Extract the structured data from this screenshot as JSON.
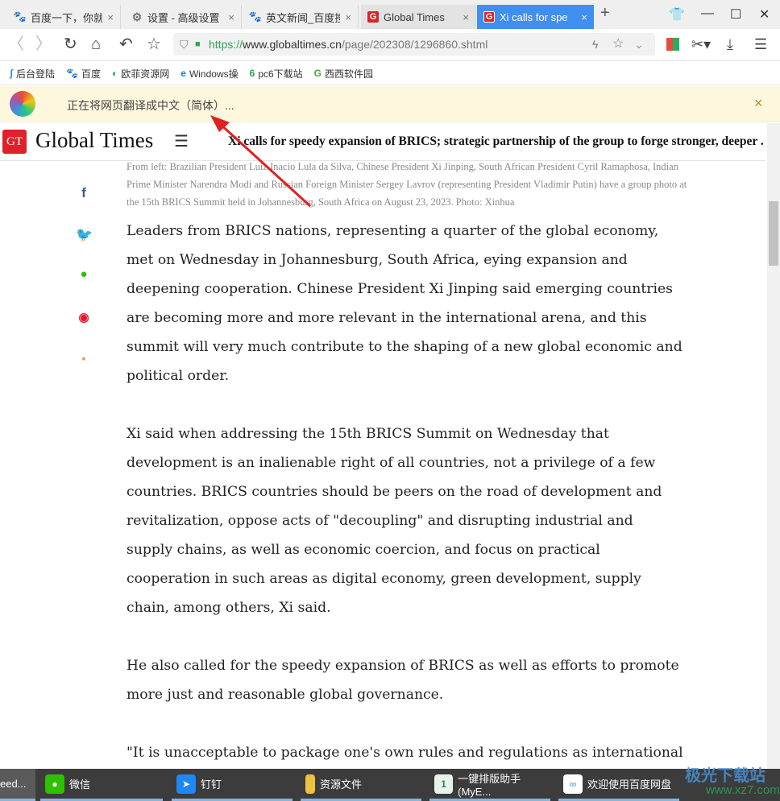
{
  "tabs": [
    {
      "label": "百度一下，你就",
      "icon": "baidu-paw-icon"
    },
    {
      "label": "设置 - 高级设置",
      "icon": "gear-icon"
    },
    {
      "label": "英文新闻_百度搜",
      "icon": "baidu-paw-icon"
    },
    {
      "label": "Global Times",
      "icon": "gt-icon"
    },
    {
      "label": "Xi calls for spe",
      "icon": "gt-icon",
      "active": true
    }
  ],
  "address": {
    "scheme": "https://",
    "host": "www.globaltimes.cn",
    "path": "/page/202308/1296860.shtml"
  },
  "bookmarks": [
    "后台登陆",
    "百度",
    "欧菲资源网",
    "Windows操",
    "pc6下载站",
    "西西软件园"
  ],
  "translate_bar": {
    "text": "正在将网页翻译成中文（简体）...",
    "close": "×"
  },
  "site": {
    "logo": "GT",
    "name": "Global Times",
    "headline": "Xi calls for speedy expansion of BRICS; strategic partnership of the group to forge stronger, deeper ..."
  },
  "caption": "From left: Brazilian President Luiz Inacio Lula da Silva, Chinese President Xi Jinping, South African President Cyril Ramaphosa, Indian Prime Minister Narendra Modi and Russian Foreign Minister Sergey Lavrov (representing President Vladimir Putin) have a group photo at the 15th BRICS Summit held in Johannesburg, South Africa on August 23, 2023. Photo: Xinhua",
  "article": [
    [
      "Leaders from BRICS nations, representing a quarter of the global economy,",
      "met on Wednesday in Johannesburg, South Africa, eying expansion and",
      "deepening cooperation. Chinese President Xi Jinping said emerging countries",
      "are becoming more and more relevant in the international arena, and this",
      "summit will very much contribute to the shaping of a new global economic and",
      "political order."
    ],
    [
      "Xi said when addressing the 15th BRICS Summit on Wednesday that",
      "development is an inalienable right of all countries, not a privilege of a few",
      "countries. BRICS countries should be peers on the road of development and",
      "revitalization, oppose acts of \"decoupling\" and disrupting industrial and",
      "supply chains, as well as economic coercion, and focus on practical",
      "cooperation in such areas as digital economy, green development, supply",
      "chain, among others, Xi said."
    ],
    [
      "He also called for the speedy expansion of BRICS as well as efforts to promote",
      "more just and reasonable global governance."
    ],
    [
      "\"It is unacceptable to package one's own rules and regulations as international"
    ]
  ],
  "taskbar": [
    {
      "label": "eed..."
    },
    {
      "label": "微信",
      "color": "#2dc100"
    },
    {
      "label": "钉钉",
      "color": "#1e88f5"
    },
    {
      "label": "资源文件",
      "color": "#f0c040"
    },
    {
      "label": "一键排版助手(MyE...",
      "color": "#2a8a5a"
    },
    {
      "label": "欢迎使用百度网盘",
      "color": "#ffffff"
    }
  ],
  "watermark": {
    "text": "极光下载站",
    "url": "www.xz7.com"
  },
  "colors": {
    "active_tab": "#3f8ff0",
    "brand_red": "#e0202a",
    "translate_bar": "#fdf7dd",
    "arrow": "#e02020"
  }
}
